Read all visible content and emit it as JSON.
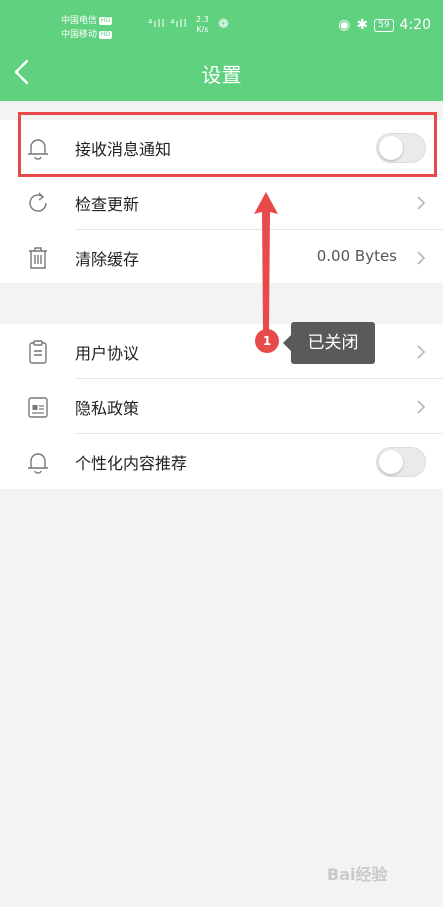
{
  "status_bar": {
    "carrier1": "中国电信",
    "carrier2": "中国移动",
    "hd": "HD",
    "speed_value": "2.3",
    "speed_unit": "K/s",
    "battery": "59",
    "time": "4:20"
  },
  "header": {
    "title": "设置"
  },
  "group1": {
    "notification_label": "接收消息通知",
    "update_label": "检查更新",
    "cache_label": "清除缓存",
    "cache_value": "0.00 Bytes"
  },
  "group2": {
    "agreement_label": "用户协议",
    "privacy_label": "隐私政策",
    "personalized_label": "个性化内容推荐"
  },
  "annotation": {
    "badge": "1",
    "tooltip": "已关闭"
  },
  "watermark": {
    "text": "Bai经验"
  },
  "colors": {
    "header": "#5fd17f",
    "annotation": "#e84a4a"
  }
}
